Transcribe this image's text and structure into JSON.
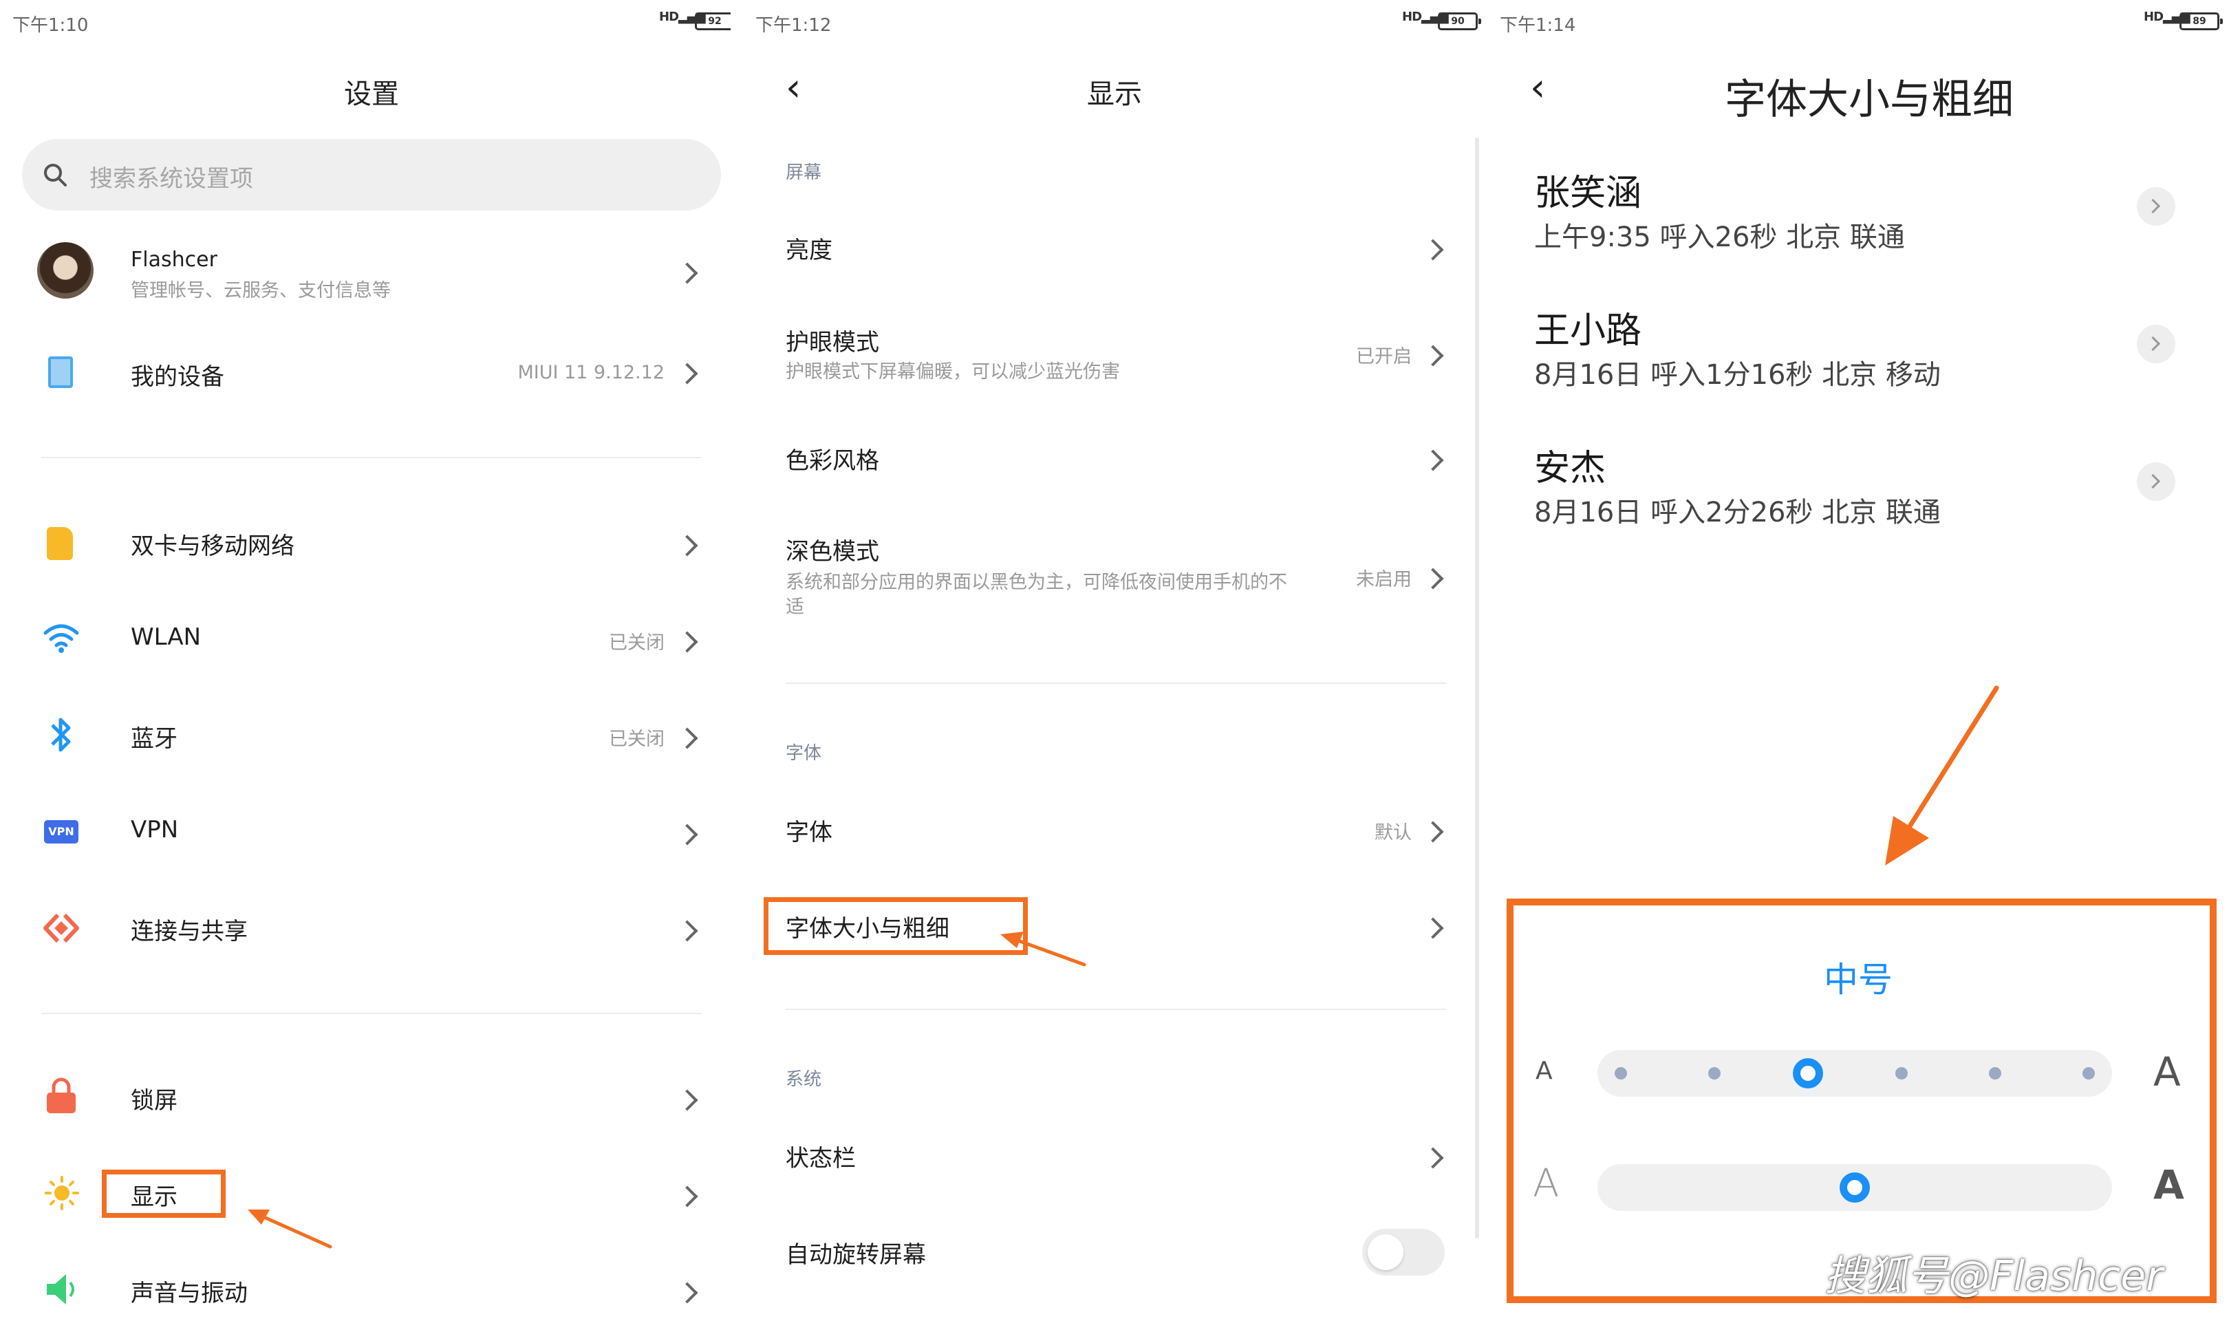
{
  "screen1": {
    "status_time": "下午1:10",
    "battery": "92",
    "title": "设置",
    "search_placeholder": "搜索系统设置项",
    "account": {
      "name": "Flashcer",
      "sub": "管理帐号、云服务、支付信息等"
    },
    "device": {
      "label": "我的设备",
      "value": "MIUI 11 9.12.12"
    },
    "network_items": [
      {
        "label": "双卡与移动网络",
        "value": ""
      },
      {
        "label": "WLAN",
        "value": "已关闭"
      },
      {
        "label": "蓝牙",
        "value": "已关闭"
      },
      {
        "label": "VPN",
        "value": ""
      },
      {
        "label": "连接与共享",
        "value": ""
      }
    ],
    "vpn_badge": "VPN",
    "system_items": [
      {
        "label": "锁屏"
      },
      {
        "label": "显示"
      },
      {
        "label": "声音与振动"
      }
    ]
  },
  "screen2": {
    "status_time": "下午1:12",
    "battery": "90",
    "title": "显示",
    "section_screen": "屏幕",
    "brightness": "亮度",
    "eye": {
      "label": "护眼模式",
      "sub": "护眼模式下屏幕偏暖，可以减少蓝光伤害",
      "value": "已开启"
    },
    "color_style": "色彩风格",
    "dark": {
      "label": "深色模式",
      "sub1": "系统和部分应用的界面以黑色为主，可降低夜间使用手机的不",
      "sub2": "适",
      "value": "未启用"
    },
    "section_font": "字体",
    "font": {
      "label": "字体",
      "value": "默认"
    },
    "font_size": "字体大小与粗细",
    "section_system": "系统",
    "status_bar": "状态栏",
    "auto_rotate": "自动旋转屏幕"
  },
  "screen3": {
    "status_time": "下午1:14",
    "battery": "89",
    "title": "字体大小与粗细",
    "contacts": [
      {
        "name": "张笑涵",
        "info": "上午9:35 呼入26秒 北京 联通"
      },
      {
        "name": "王小路",
        "info": "8月16日 呼入1分16秒 北京 移动"
      },
      {
        "name": "安杰",
        "info": "8月16日 呼入2分26秒 北京 联通"
      }
    ],
    "size_label": "中号",
    "size_slider": {
      "steps": 6,
      "selected_index": 2
    },
    "weight_slider": {
      "position_fraction": 0.5
    },
    "small_a": "A",
    "large_a": "A"
  },
  "watermark": "搜狐号@Flashcer",
  "colors": {
    "accent_blue": "#1a8ff5",
    "highlight_orange": "#f26f21"
  }
}
